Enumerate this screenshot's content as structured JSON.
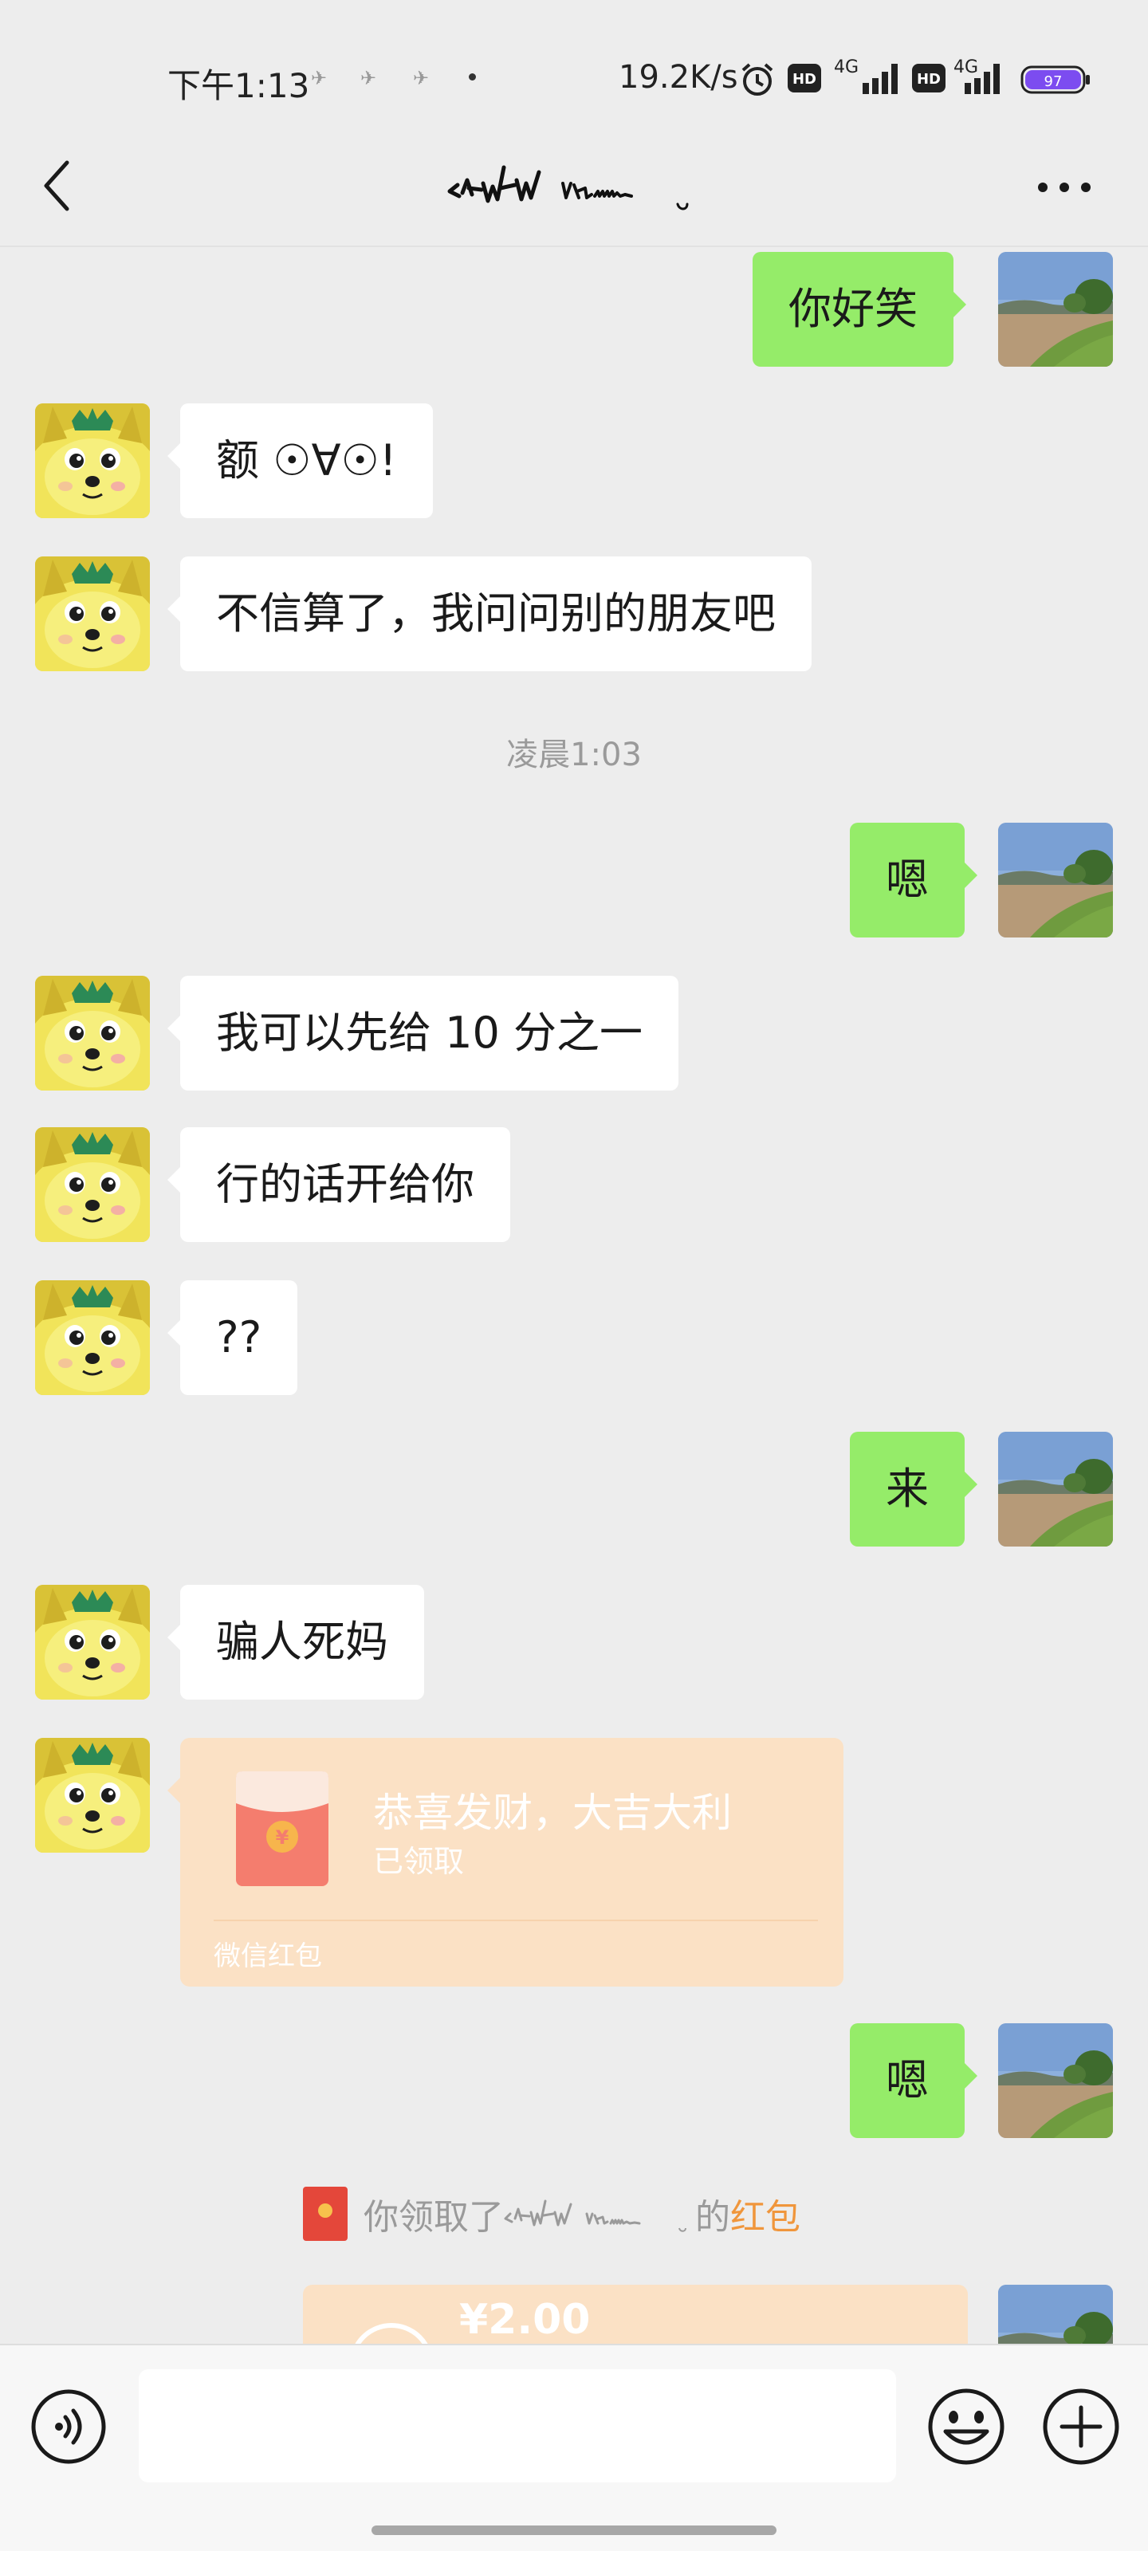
{
  "status_bar": {
    "time": "下午1:13",
    "net_speed": "19.2K/s",
    "hd_badge_1": "HD",
    "hd_badge_2": "HD",
    "network_1": "4G",
    "network_2": "4G",
    "battery": "97"
  },
  "header": {
    "title_kind": "handwritten signature (image)"
  },
  "messages": [
    {
      "id": 1,
      "side": "out",
      "text": "你好笑"
    },
    {
      "id": 2,
      "side": "in",
      "text": "额 ☉∀☉!"
    },
    {
      "id": 3,
      "side": "in",
      "text": "不信算了，我问问别的朋友吧"
    },
    {
      "id": 4,
      "side": "out",
      "text": "嗯"
    },
    {
      "id": 5,
      "side": "in",
      "text": "我可以先给 10 分之一"
    },
    {
      "id": 6,
      "side": "in",
      "text": "行的话开给你"
    },
    {
      "id": 7,
      "side": "in",
      "text": "??"
    },
    {
      "id": 8,
      "side": "out",
      "text": "来"
    },
    {
      "id": 9,
      "side": "in",
      "text": "骗人死妈"
    },
    {
      "id": 10,
      "side": "out",
      "text": "嗯"
    }
  ],
  "timestamp": "凌晨1:03",
  "red_packet": {
    "title": "恭喜发财，大吉大利",
    "status": "已领取",
    "footer": "微信红包",
    "symbol": "¥"
  },
  "system_notice": {
    "prefix": "你领取了",
    "suffix": "的",
    "link": "红包"
  },
  "sent_packet": {
    "amount": "¥2.00"
  },
  "input": {
    "value": ""
  },
  "colors": {
    "background": "#ededed",
    "out_bubble": "#95ec69",
    "in_bubble": "#ffffff",
    "packet": "#fbe1c5",
    "link": "#f0963c"
  }
}
